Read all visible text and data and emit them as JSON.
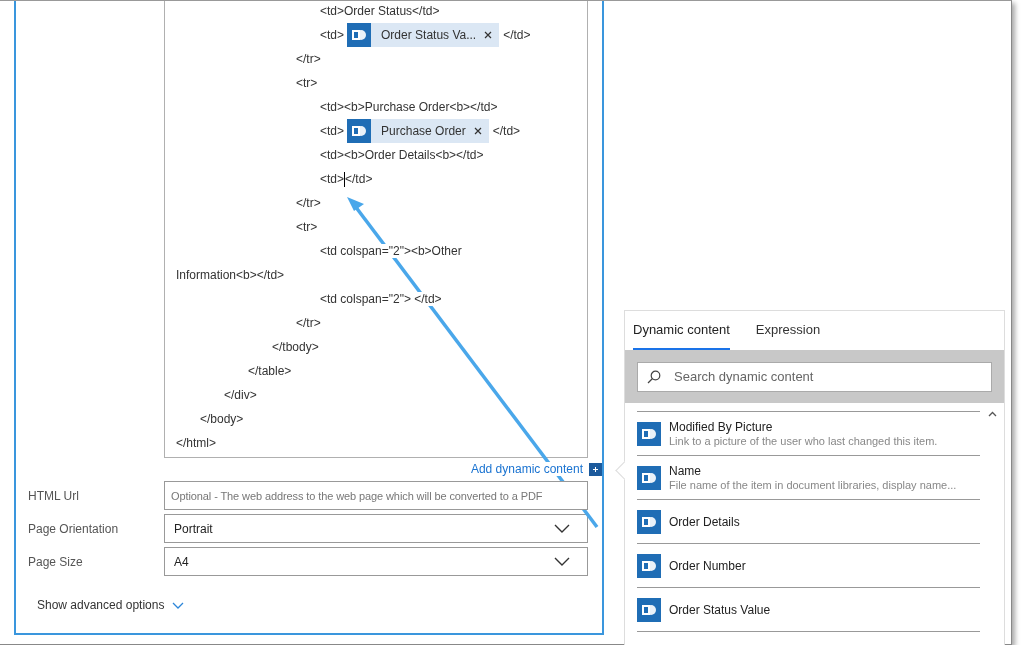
{
  "editor": {
    "lines": [
      {
        "segments": [
          {
            "kind": "text",
            "text": "\t\t\t\t\t\t<td>Order Status</td>"
          }
        ]
      },
      {
        "segments": [
          {
            "kind": "text",
            "text": "\t\t\t\t\t\t<td>"
          },
          {
            "kind": "token",
            "label": "Order Status Va..."
          },
          {
            "kind": "text",
            "text": "</td>"
          }
        ]
      },
      {
        "segments": [
          {
            "kind": "text",
            "text": "\t\t\t\t\t</tr>"
          }
        ]
      },
      {
        "segments": [
          {
            "kind": "text",
            "text": "\t\t\t\t\t<tr>"
          }
        ]
      },
      {
        "segments": [
          {
            "kind": "text",
            "text": "\t\t\t\t\t\t<td><b>Purchase Order<b></td>"
          }
        ]
      },
      {
        "segments": [
          {
            "kind": "text",
            "text": "\t\t\t\t\t\t<td>"
          },
          {
            "kind": "token",
            "label": "Purchase Order"
          },
          {
            "kind": "text",
            "text": "</td>"
          }
        ]
      },
      {
        "segments": [
          {
            "kind": "text",
            "text": "\t\t\t\t\t\t<td><b>Order Details<b></td>"
          }
        ]
      },
      {
        "segments": [
          {
            "kind": "text",
            "text": "\t\t\t\t\t\t<td>"
          },
          {
            "kind": "cursor"
          },
          {
            "kind": "text",
            "text": "</td>"
          }
        ]
      },
      {
        "segments": [
          {
            "kind": "text",
            "text": "\t\t\t\t\t</tr>"
          }
        ]
      },
      {
        "segments": [
          {
            "kind": "text",
            "text": "\t\t\t\t\t<tr>"
          }
        ]
      },
      {
        "segments": [
          {
            "kind": "text",
            "text": "\t\t\t\t\t\t<td colspan=\"2\"><b>Other"
          }
        ]
      },
      {
        "segments": [
          {
            "kind": "text",
            "text": "Information<b></td>"
          }
        ]
      },
      {
        "segments": [
          {
            "kind": "text",
            "text": "\t\t\t\t\t\t<td colspan=\"2\"> </td>"
          }
        ]
      },
      {
        "segments": [
          {
            "kind": "text",
            "text": "\t\t\t\t\t</tr>"
          }
        ]
      },
      {
        "segments": [
          {
            "kind": "text",
            "text": "\t\t\t\t</tbody>"
          }
        ]
      },
      {
        "segments": [
          {
            "kind": "text",
            "text": "\t\t\t</table>"
          }
        ]
      },
      {
        "segments": [
          {
            "kind": "text",
            "text": "\t\t</div>"
          }
        ]
      },
      {
        "segments": [
          {
            "kind": "text",
            "text": "\t</body>"
          }
        ]
      },
      {
        "segments": [
          {
            "kind": "text",
            "text": "</html>"
          }
        ]
      }
    ]
  },
  "add_dynamic_content": "Add dynamic content",
  "fields": [
    {
      "label": "HTML Url",
      "kind": "text",
      "placeholder": "Optional - The web address to the web page which will be converted to a PDF"
    },
    {
      "label": "Page Orientation",
      "kind": "dropdown",
      "value": "Portrait"
    },
    {
      "label": "Page Size",
      "kind": "dropdown",
      "value": "A4"
    }
  ],
  "advanced_options": {
    "label": "Show advanced options",
    "expanded": false
  },
  "dynamic_panel": {
    "tabs": [
      {
        "label": "Dynamic content",
        "selected": true
      },
      {
        "label": "Expression",
        "selected": false
      }
    ],
    "search": {
      "placeholder": "Search dynamic content"
    },
    "items": [
      {
        "title": "Modified By Picture",
        "description": "Link to a picture of the user who last changed this item."
      },
      {
        "title": "Name",
        "description": "File name of the item in document libraries, display name..."
      },
      {
        "title": "Order Details"
      },
      {
        "title": "Order Number"
      },
      {
        "title": "Order Status Value"
      }
    ]
  }
}
